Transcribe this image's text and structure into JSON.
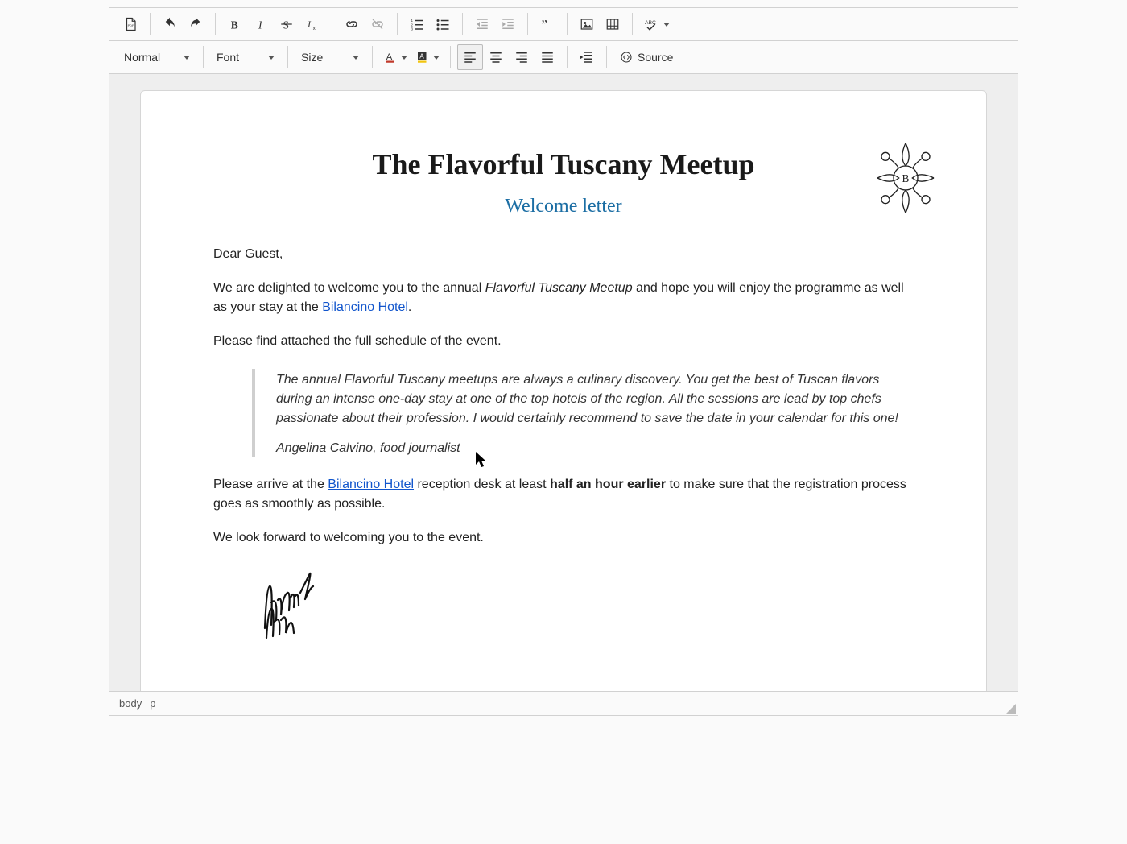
{
  "toolbar1": {
    "icons": {
      "pdf": "pdf-icon",
      "undo": "undo-icon",
      "redo": "redo-icon",
      "bold": "bold-icon",
      "italic": "italic-icon",
      "strike": "strike-icon",
      "removeformat": "remove-format-icon",
      "link": "link-icon",
      "unlink": "unlink-icon",
      "numbered": "numbered-list-icon",
      "bulleted": "bullet-list-icon",
      "outdent": "outdent-icon",
      "indent": "indent-icon",
      "blockquote": "blockquote-icon",
      "image": "image-icon",
      "table": "table-icon",
      "spellcheck": "spellcheck-icon"
    }
  },
  "toolbar2": {
    "format_label": "Normal",
    "font_label": "Font",
    "size_label": "Size",
    "source_label": "Source"
  },
  "document": {
    "title": "The Flavorful Tuscany Meetup",
    "subtitle": "Welcome letter",
    "greeting": "Dear Guest,",
    "p1_pre": "We are delighted to welcome you to the annual ",
    "p1_ital": "Flavorful Tuscany Meetup",
    "p1_mid": " and hope you will enjoy the programme as well as your stay at the ",
    "p1_link": "Bilancino Hotel",
    "p1_post": ".",
    "p2": "Please find attached the full schedule of the event.",
    "quote_text": "The annual Flavorful Tuscany meetups are always a culinary discovery. You get the best of Tuscan flavors during an intense one-day stay at one of the top hotels of the region. All the sessions are lead by top chefs passionate about their profession. I would certainly recommend to save the date in your calendar for this one!",
    "quote_attrib": "Angelina Calvino, food journalist",
    "p3_pre": "Please arrive at the ",
    "p3_link": "Bilancino Hotel",
    "p3_mid": " reception desk at least ",
    "p3_bold": "half an hour earlier",
    "p3_post": " to make sure that the registration process goes as smoothly as possible.",
    "p4": "We look forward to welcoming you to the event.",
    "signature_name": "Victoria Valc"
  },
  "pathbar": {
    "el1": "body",
    "el2": "p"
  },
  "colors": {
    "accent": "#1c6ea4",
    "link": "#1155cc"
  }
}
